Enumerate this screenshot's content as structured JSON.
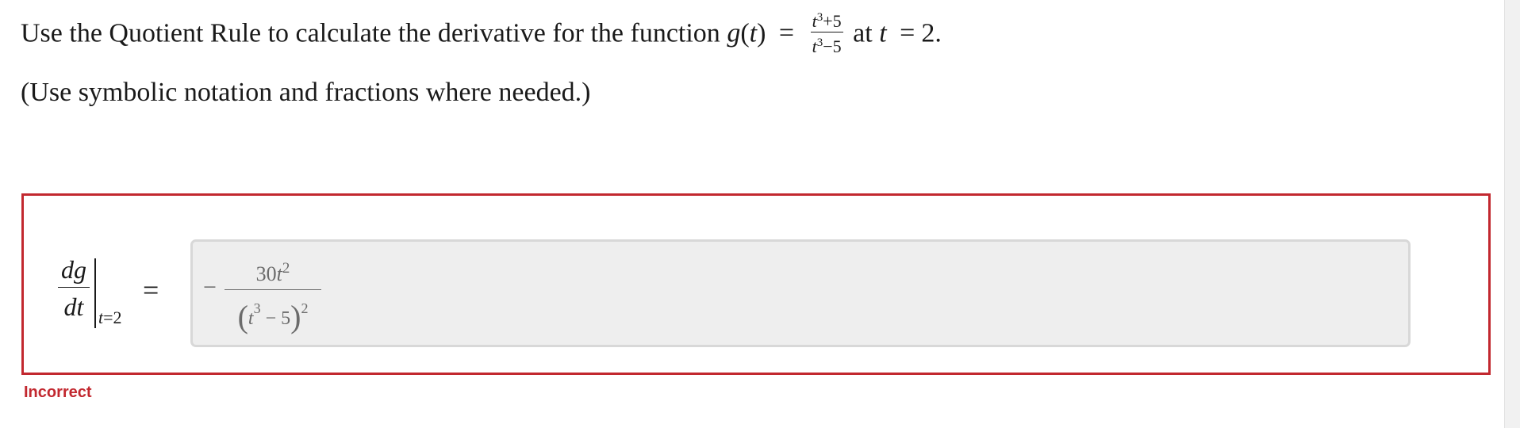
{
  "question": {
    "prefix": "Use the Quotient Rule to calculate the derivative for the function",
    "func_name": "g",
    "func_var": "t",
    "equals": "=",
    "frac_num_base": "t",
    "frac_num_exp": "3",
    "frac_num_rest": "+5",
    "frac_den_base": "t",
    "frac_den_exp": "3",
    "frac_den_rest": "−5",
    "at_word": "at",
    "at_var": "t",
    "at_equals": "=",
    "at_value": "2."
  },
  "hint": "(Use symbolic notation and fractions where needed.)",
  "lhs": {
    "numerator": "dg",
    "denominator": "dt",
    "eval_var": "t",
    "eval_eq": "=2",
    "equals": "="
  },
  "answer": {
    "sign": "−",
    "num_coef": "30",
    "num_var": "t",
    "num_exp": "2",
    "den_open": "(",
    "den_var": "t",
    "den_var_exp": "3",
    "den_rest": " − 5",
    "den_close": ")",
    "den_exp": "2"
  },
  "status": {
    "text": "Incorrect",
    "color": "#c2282f"
  }
}
